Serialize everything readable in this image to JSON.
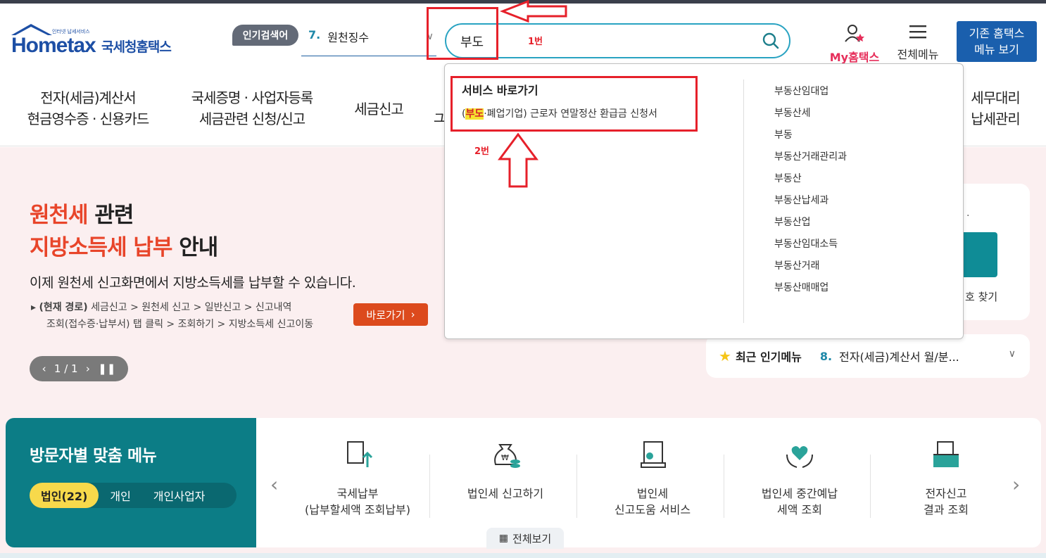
{
  "header": {
    "logo_tiny": "인터넷 납세서비스",
    "logo_brand": "Hometax",
    "logo_korean": "국세청홈택스",
    "popular_tag": "인기검색어",
    "popular_num": "7.",
    "popular_value": "원천징수",
    "search_value": "부도",
    "my_hometax": "My홈택스",
    "all_menu": "전체메뉴",
    "old_home_line1": "기존 홈택스",
    "old_home_line2": "메뉴 보기"
  },
  "annotations": {
    "label_1": "1번",
    "label_2": "2번",
    "red_color": "#e6202a"
  },
  "nav": {
    "item1_line1": "전자(세금)계산서",
    "item1_line2": "현금영수증 · 신용카드",
    "item2_line1": "국세증명 · 사업자등록",
    "item2_line2": "세금관련 신청/신고",
    "item3": "세금신고",
    "item4_partial": "ユ",
    "item_last_line1": "세무대리",
    "item_last_line2": "납세관리"
  },
  "dropdown": {
    "service_title": "서비스 바로가기",
    "service_prefix": "(",
    "service_highlight": "부도",
    "service_rest": "·폐업기업) 근로자 연말정산 환급금 신청서",
    "suggestions": [
      "부동산임대업",
      "부동산세",
      "부동",
      "부동산거래관리과",
      "부동산",
      "부동산납세과",
      "부동산업",
      "부동산임대소득",
      "부동산거래",
      "부동산매매업"
    ]
  },
  "hero": {
    "title_line1_red": "원천세",
    "title_line1_black": " 관련",
    "title_line2_red": "지방소득세 납부",
    "title_line2_black": " 안내",
    "subtitle": "이제 원천세 신고화면에서 지방소득세를 납부할 수 있습니다.",
    "path_bold": "(현재 경로)",
    "path_line1": " 세금신고 > 원천세 신고 > 일반신고 > 신고내역",
    "path_line2": "조회(접수증·납부서) 탭 클릭 > 조회하기 > 지방소득세 신고이동",
    "go_button": "바로가기",
    "pager": "1 / 1"
  },
  "right_card": {
    "find_text": "호 찾기",
    "dot": "."
  },
  "recent": {
    "title": "최근 인기메뉴",
    "num": "8.",
    "value": "전자(세금)계산서 월/분..."
  },
  "visitor": {
    "title": "방문자별 맞춤 메뉴",
    "tab_corp": "법인(22)",
    "tab_personal": "개인",
    "tab_biz": "개인사업자"
  },
  "menu": {
    "items": [
      {
        "line1": "국세납부",
        "line2": "(납부할세액 조회납부)"
      },
      {
        "line1": "법인세 신고하기",
        "line2": ""
      },
      {
        "line1": "법인세",
        "line2": "신고도움 서비스"
      },
      {
        "line1": "법인세 중간예납",
        "line2": "세액 조회"
      },
      {
        "line1": "전자신고",
        "line2": "결과 조회"
      }
    ],
    "full_view": "전체보기"
  }
}
